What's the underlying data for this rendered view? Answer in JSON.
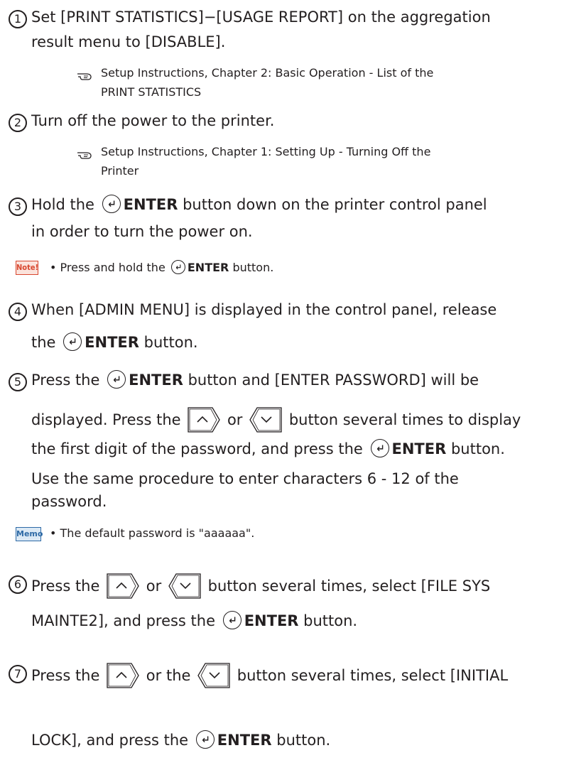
{
  "steps": [
    {
      "num": "1",
      "line1": "Set [PRINT STATISTICS]−[USAGE REPORT] on the aggregation",
      "line2": "result menu to [DISABLE].",
      "ref1": "Setup Instructions, Chapter 2: Basic Operation - List of the",
      "ref2": "PRINT STATISTICS"
    },
    {
      "num": "2",
      "line1": "Turn off the power to the printer.",
      "ref1": "Setup Instructions, Chapter 1: Setting Up - Turning Off the",
      "ref2": "Printer"
    },
    {
      "num": "3",
      "line1_a": "Hold the",
      "enter": "ENTER",
      "line1_b": "button down on the printer control panel",
      "line2": "in order to turn the power on.",
      "note_label": "Note!",
      "note_a": "• Press and hold the",
      "note_b": "button."
    },
    {
      "num": "4",
      "line1": "When [ADMIN MENU] is displayed in the control panel, release",
      "line2_a": "the",
      "line2_b": "button."
    },
    {
      "num": "5",
      "line1_a": "Press the",
      "line1_b": "button and [ENTER PASSWORD] will be",
      "line2_a": "displayed. Press the",
      "line2_b": "or",
      "line2_c": "button several times to display",
      "line3_a": "the first digit of the password, and press the",
      "line3_b": "button.",
      "line4": "Use the same procedure to enter characters 6 - 12 of the",
      "line5": "password.",
      "memo_label": "Memo",
      "memo_text": "• The default password is \"aaaaaa\"."
    },
    {
      "num": "6",
      "line1_a": "Press the",
      "line1_b": "or",
      "line1_c": "button several times, select [FILE SYS",
      "line2_a": "MAINTE2], and press the",
      "line2_b": "button."
    },
    {
      "num": "7",
      "line1_a": "Press the",
      "line1_b": "or the",
      "line1_c": "button several times, select [INITIAL",
      "line2_a": "LOCK], and press the",
      "line2_b": "button."
    }
  ]
}
